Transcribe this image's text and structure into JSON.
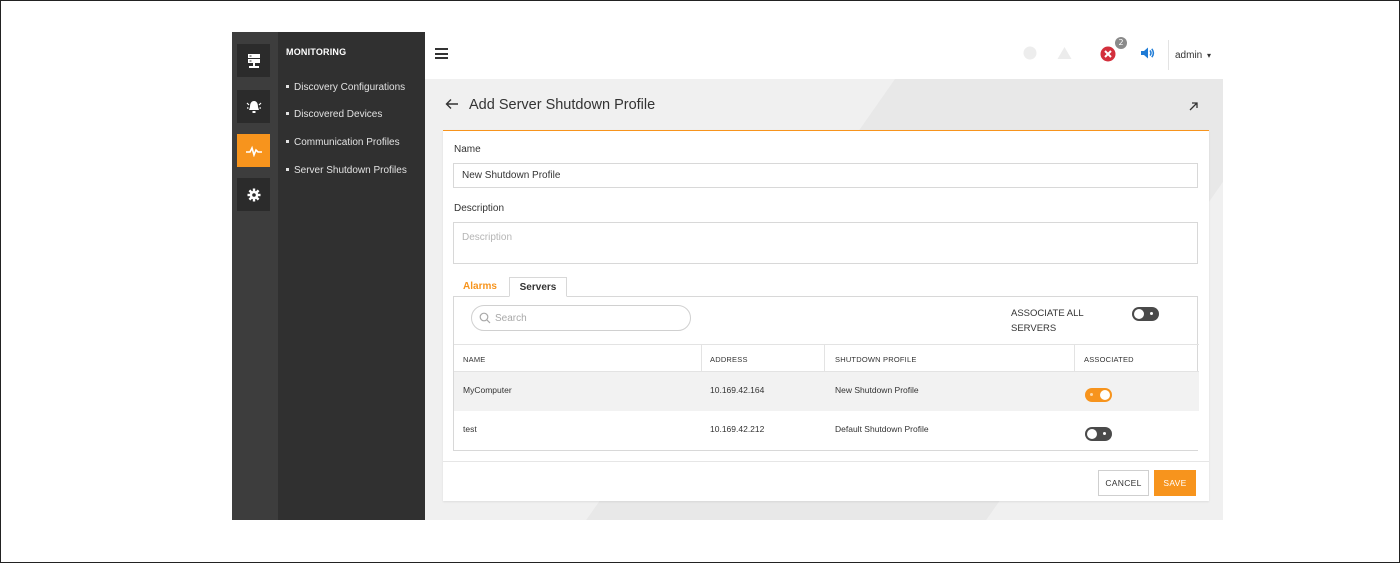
{
  "nav": {
    "title": "MONITORING",
    "items": [
      {
        "label": "Discovery Configurations"
      },
      {
        "label": "Discovered Devices"
      },
      {
        "label": "Communication Profiles"
      },
      {
        "label": "Server Shutdown Profiles"
      }
    ]
  },
  "rail": {
    "icons": [
      "server-icon",
      "bell-alarm-icon",
      "pulse-icon",
      "gear-icon"
    ],
    "active": "pulse-icon"
  },
  "topbar": {
    "alert_count": "2",
    "user": "admin"
  },
  "page": {
    "title": "Add Server Shutdown Profile"
  },
  "form": {
    "name_label": "Name",
    "name_value": "New Shutdown Profile",
    "description_label": "Description",
    "description_placeholder": "Description"
  },
  "tabs": [
    {
      "label": "Alarms"
    },
    {
      "label": "Servers"
    }
  ],
  "servers": {
    "search_placeholder": "Search",
    "associate_all_label": "ASSOCIATE ALL SERVERS",
    "associate_all": false,
    "columns": [
      "NAME",
      "ADDRESS",
      "SHUTDOWN PROFILE",
      "ASSOCIATED"
    ],
    "rows": [
      {
        "name": "MyComputer",
        "address": "10.169.42.164",
        "profile": "New Shutdown Profile",
        "associated": true
      },
      {
        "name": "test",
        "address": "10.169.42.212",
        "profile": "Default Shutdown Profile",
        "associated": false
      }
    ]
  },
  "actions": {
    "cancel": "CANCEL",
    "save": "SAVE"
  },
  "colors": {
    "accent": "#f7941d",
    "error": "#d32f3c",
    "info": "#1e7bd6"
  }
}
